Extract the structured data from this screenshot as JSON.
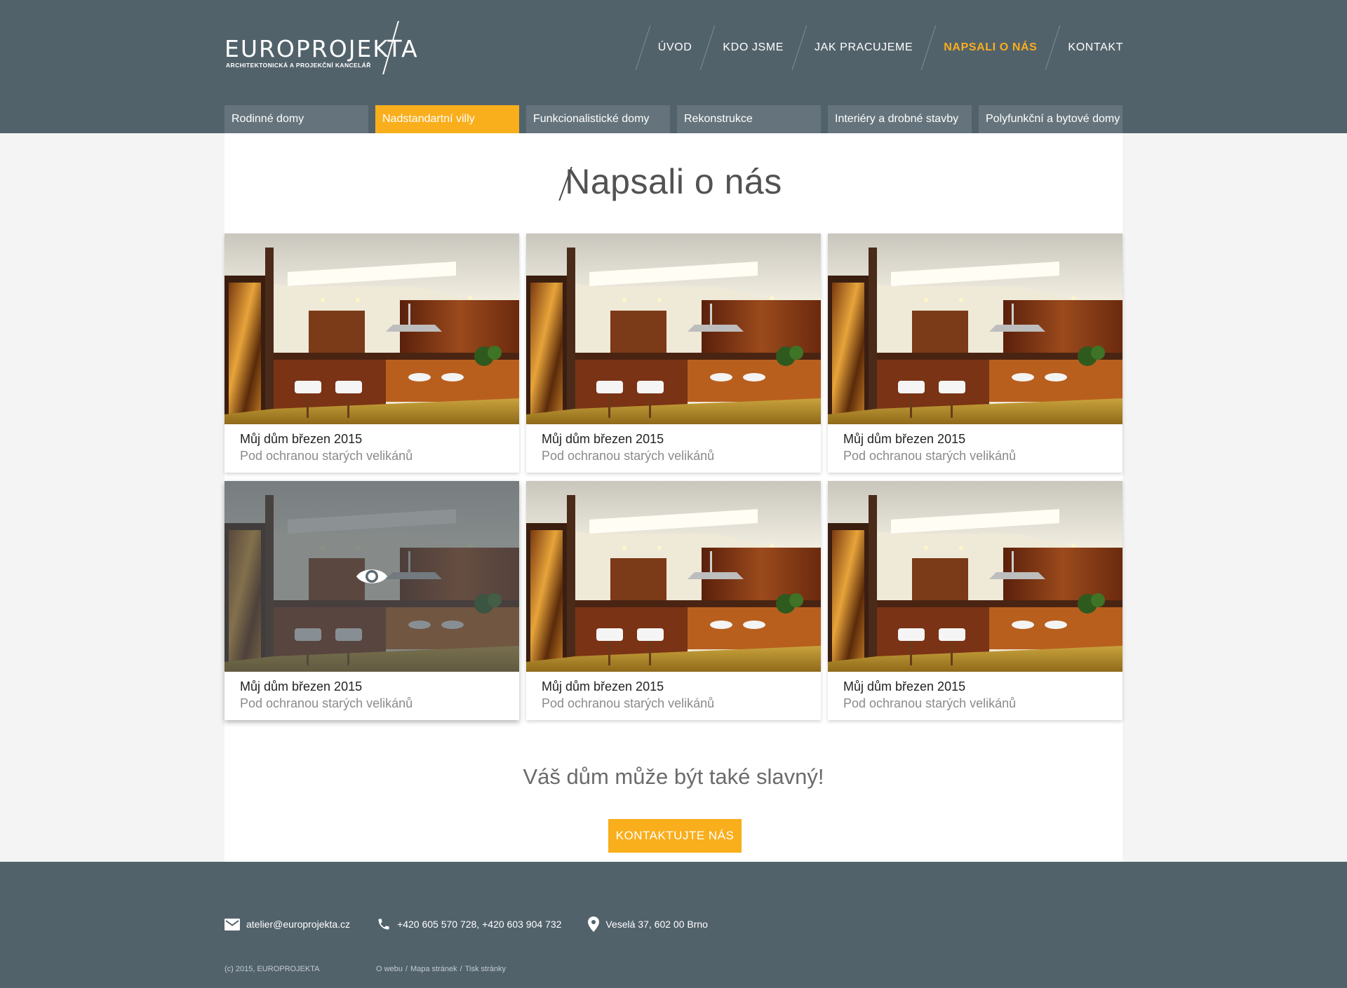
{
  "brand": {
    "name": "EUROPROJEKTA",
    "tagline": "ARCHITEKTONICKÁ A PROJEKČNÍ KANCELÁŘ"
  },
  "nav": {
    "items": [
      {
        "label": "ÚVOD"
      },
      {
        "label": "KDO JSME"
      },
      {
        "label": "JAK PRACUJEME"
      },
      {
        "label": "NAPSALI O NÁS",
        "active": true
      },
      {
        "label": "KONTAKT"
      }
    ]
  },
  "categories": [
    {
      "label": "Rodinné domy"
    },
    {
      "label": "Nadstandartní villy",
      "active": true
    },
    {
      "label": "Funkcionalistické domy"
    },
    {
      "label": "Rekonstrukce"
    },
    {
      "label": "Interiéry a drobné stavby"
    },
    {
      "label": "Polyfunkční a bytové domy"
    }
  ],
  "page": {
    "title": "Napsali o nás"
  },
  "articles": [
    {
      "title": "Můj dům březen 2015",
      "subtitle": "Pod ochranou starých velikánů"
    },
    {
      "title": "Můj dům březen 2015",
      "subtitle": "Pod ochranou starých velikánů"
    },
    {
      "title": "Můj dům březen 2015",
      "subtitle": "Pod ochranou starých velikánů"
    },
    {
      "title": "Můj dům březen 2015",
      "subtitle": "Pod ochranou starých velikánů",
      "hovered": true
    },
    {
      "title": "Můj dům březen 2015",
      "subtitle": "Pod ochranou starých velikánů"
    },
    {
      "title": "Můj dům březen 2015",
      "subtitle": "Pod ochranou starých velikánů"
    }
  ],
  "cta": {
    "text": "Váš dům může být také slavný!",
    "button_label": "KONTAKTUJTE NÁS"
  },
  "footer": {
    "email": "atelier@europrojekta.cz",
    "phone": "+420 605 570 728, +420 603 904 732",
    "address": "Veselá 37, 602 00 Brno",
    "copyright": "(c) 2015, EUROPROJEKTA",
    "links": [
      "O webu",
      "Mapa stránek",
      "Tisk stránky"
    ]
  },
  "colors": {
    "header_bg": "#52626b",
    "accent": "#f9ae1c",
    "tab_bg": "#65747c"
  }
}
